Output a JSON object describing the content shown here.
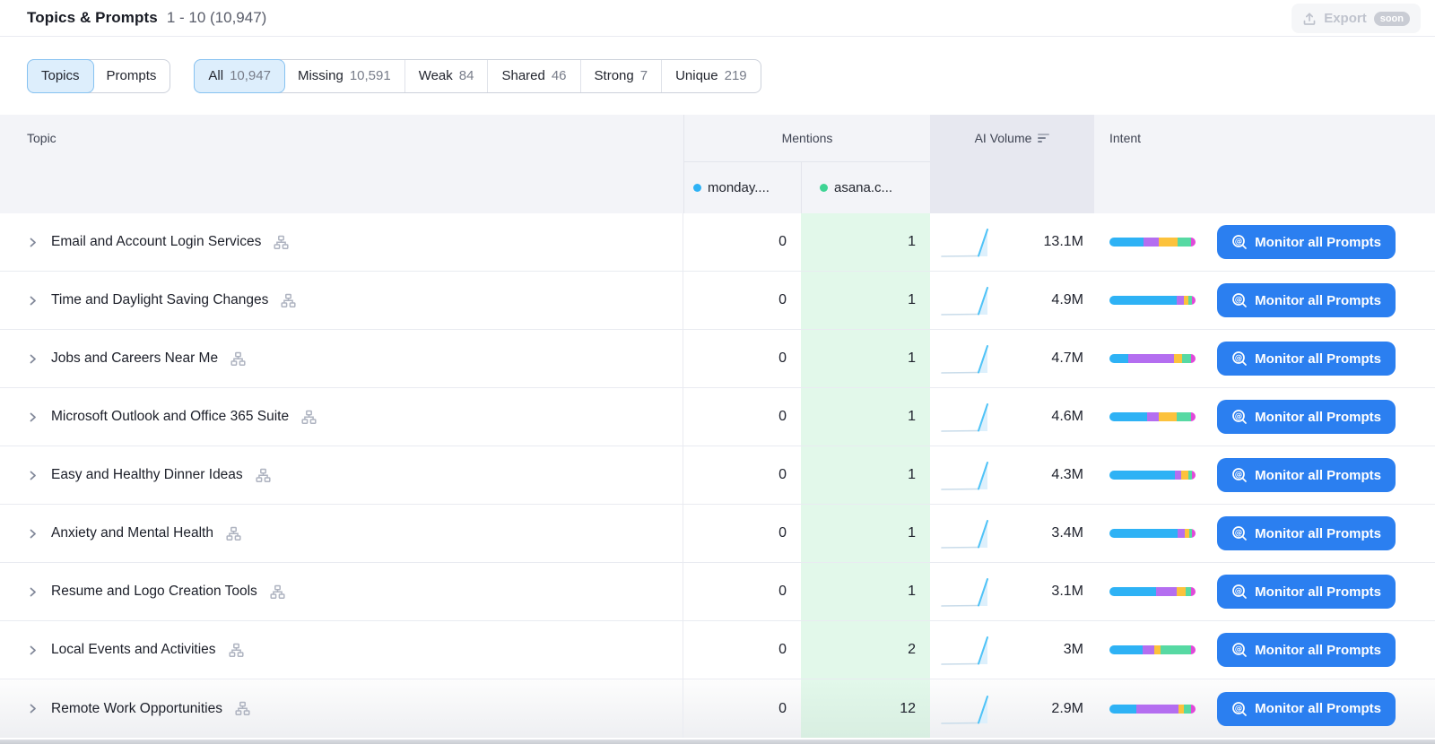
{
  "header": {
    "title": "Topics & Prompts",
    "range": "1 - 10 (10,947)",
    "export_label": "Export",
    "export_badge": "soon"
  },
  "view_tabs": [
    {
      "label": "Topics",
      "active": true
    },
    {
      "label": "Prompts",
      "active": false
    }
  ],
  "filters": [
    {
      "label": "All",
      "count": "10,947",
      "active": true
    },
    {
      "label": "Missing",
      "count": "10,591",
      "active": false
    },
    {
      "label": "Weak",
      "count": "84",
      "active": false
    },
    {
      "label": "Shared",
      "count": "46",
      "active": false
    },
    {
      "label": "Strong",
      "count": "7",
      "active": false
    },
    {
      "label": "Unique",
      "count": "219",
      "active": false
    }
  ],
  "table": {
    "columns": {
      "topic": "Topic",
      "mentions": "Mentions",
      "ai_volume": "AI Volume",
      "intent": "Intent"
    },
    "competitors": [
      {
        "label": "monday....",
        "color": "#2eb2f5"
      },
      {
        "label": "asana.c...",
        "color": "#3ed494"
      }
    ],
    "monitor_button_label": "Monitor all Prompts",
    "rows": [
      {
        "topic": "Email and Account Login Services",
        "monday": "0",
        "asana": "1",
        "ai_volume": "13.1M",
        "intent": [
          40,
          17,
          22,
          16,
          5
        ]
      },
      {
        "topic": "Time and Daylight Saving Changes",
        "monday": "0",
        "asana": "1",
        "ai_volume": "4.9M",
        "intent": [
          78,
          8,
          6,
          4,
          4
        ]
      },
      {
        "topic": "Jobs and Careers Near Me",
        "monday": "0",
        "asana": "1",
        "ai_volume": "4.7M",
        "intent": [
          22,
          53,
          9,
          11,
          5
        ]
      },
      {
        "topic": "Microsoft Outlook and Office 365 Suite",
        "monday": "0",
        "asana": "1",
        "ai_volume": "4.6M",
        "intent": [
          44,
          13,
          21,
          17,
          5
        ]
      },
      {
        "topic": "Easy and Healthy Dinner Ideas",
        "monday": "0",
        "asana": "1",
        "ai_volume": "4.3M",
        "intent": [
          76,
          7,
          9,
          4,
          4
        ]
      },
      {
        "topic": "Anxiety and Mental Health",
        "monday": "0",
        "asana": "1",
        "ai_volume": "3.4M",
        "intent": [
          79,
          8,
          6,
          3,
          4
        ]
      },
      {
        "topic": "Resume and Logo Creation Tools",
        "monday": "0",
        "asana": "1",
        "ai_volume": "3.1M",
        "intent": [
          54,
          24,
          11,
          6,
          5
        ]
      },
      {
        "topic": "Local Events and Activities",
        "monday": "0",
        "asana": "2",
        "ai_volume": "3M",
        "intent": [
          39,
          13,
          7,
          36,
          5
        ]
      },
      {
        "topic": "Remote Work Opportunities",
        "monday": "0",
        "asana": "12",
        "ai_volume": "2.9M",
        "intent": [
          31,
          49,
          6,
          9,
          5
        ]
      }
    ]
  },
  "intent_colors": [
    "#2eb2f5",
    "#b46ef0",
    "#fcc23c",
    "#57d9a3",
    "#e04ad9"
  ],
  "accent_blue": "#2b7ff0",
  "shared_cell_green": "#e2f8ea"
}
